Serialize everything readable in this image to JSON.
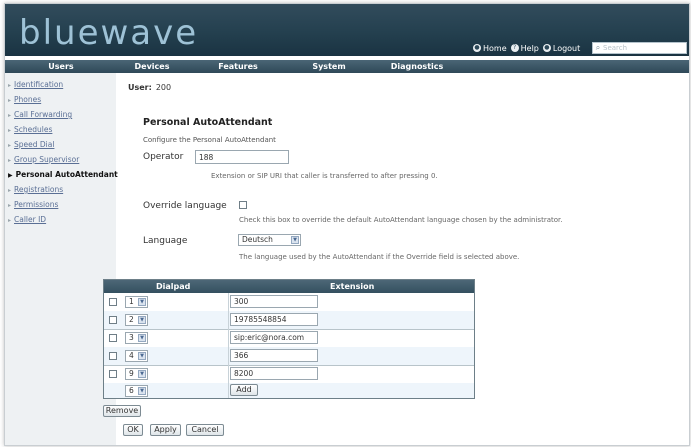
{
  "app": {
    "logo": "bluewave"
  },
  "toplinks": [
    {
      "label": "Home",
      "icon": "home-icon"
    },
    {
      "label": "Help",
      "icon": "help-icon"
    },
    {
      "label": "Logout",
      "icon": "logout-icon"
    }
  ],
  "search": {
    "placeholder": "Search",
    "value": ""
  },
  "nav": [
    "Users",
    "Devices",
    "Features",
    "System",
    "Diagnostics"
  ],
  "sidebar": {
    "items": [
      {
        "label": "Identification",
        "active": false
      },
      {
        "label": "Phones",
        "active": false
      },
      {
        "label": "Call Forwarding",
        "active": false
      },
      {
        "label": "Schedules",
        "active": false
      },
      {
        "label": "Speed Dial",
        "active": false
      },
      {
        "label": "Group Supervisor",
        "active": false
      },
      {
        "label": "Personal AutoAttendant",
        "active": true
      },
      {
        "label": "Registrations",
        "active": false
      },
      {
        "label": "Permissions",
        "active": false
      },
      {
        "label": "Caller ID",
        "active": false
      }
    ]
  },
  "page": {
    "user_label": "User:",
    "user_value": "200",
    "title": "Personal AutoAttendant",
    "subtitle": "Configure the Personal AutoAttendant",
    "operator": {
      "label": "Operator",
      "value": "188",
      "hint": "Extension or SIP URI that caller is transferred to after pressing 0."
    },
    "override": {
      "label": "Override language",
      "checked": false,
      "hint": "Check this box to override the default AutoAttendant language chosen by the administrator."
    },
    "language": {
      "label": "Language",
      "value": "Deutsch",
      "hint": "The language used by the AutoAttendant if the Override field is selected above."
    }
  },
  "table": {
    "headers": [
      "Dialpad",
      "Extension"
    ],
    "rows": [
      {
        "dialpad": "1",
        "extension": "300"
      },
      {
        "dialpad": "2",
        "extension": "19785548854"
      },
      {
        "dialpad": "3",
        "extension": "sip:eric@nora.com"
      },
      {
        "dialpad": "4",
        "extension": "366"
      },
      {
        "dialpad": "9",
        "extension": "8200"
      }
    ],
    "new_row": {
      "dialpad": "6",
      "add_label": "Add"
    }
  },
  "buttons": {
    "remove": "Remove",
    "ok": "OK",
    "apply": "Apply",
    "cancel": "Cancel"
  },
  "colors": {
    "header_bg": "#24404f",
    "logo": "#9ec2d6",
    "link": "#5a6f95",
    "row_alt": "#eef5fb"
  }
}
